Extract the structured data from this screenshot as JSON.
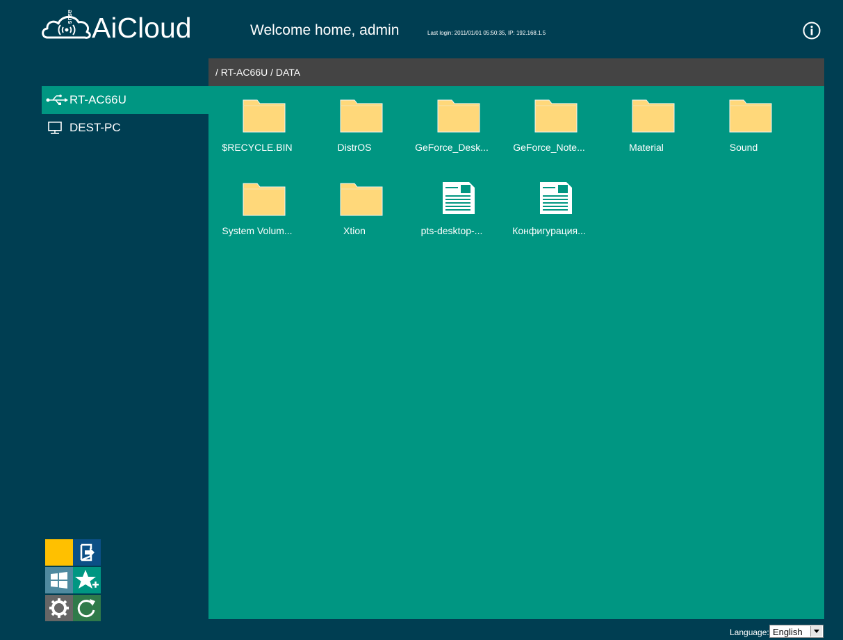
{
  "header": {
    "logo_text": "AiCloud",
    "logo_brand": "asus",
    "welcome": "Welcome home, admin",
    "last_login": "Last login: 2011/01/01 05:50:35, IP: 192.168.1.5",
    "info_icon": "info-icon"
  },
  "breadcrumb": {
    "path": "/ RT-AC66U / DATA"
  },
  "sidebar": {
    "items": [
      {
        "label": "RT-AC66U",
        "icon": "usb-icon",
        "active": true
      },
      {
        "label": "DEST-PC",
        "icon": "monitor-icon",
        "active": false
      }
    ]
  },
  "files": [
    {
      "name": "$RECYCLE.BIN",
      "type": "folder"
    },
    {
      "name": "DistrOS",
      "type": "folder"
    },
    {
      "name": "GeForce_Desk...",
      "type": "folder"
    },
    {
      "name": "GeForce_Note...",
      "type": "folder"
    },
    {
      "name": "Material",
      "type": "folder"
    },
    {
      "name": "Sound",
      "type": "folder"
    },
    {
      "name": "System Volum...",
      "type": "folder"
    },
    {
      "name": "Xtion",
      "type": "folder"
    },
    {
      "name": "pts-desktop-...",
      "type": "file"
    },
    {
      "name": "Конфигурация...",
      "type": "file"
    }
  ],
  "quick_tiles": [
    {
      "icon": "blank-tile",
      "color": "#ffc000"
    },
    {
      "icon": "logout-icon",
      "color": "#0b4f86"
    },
    {
      "icon": "windows-icon",
      "color": "#4f8aa0"
    },
    {
      "icon": "favorite-add-icon",
      "color": "#009682"
    },
    {
      "icon": "gear-icon",
      "color": "#666666"
    },
    {
      "icon": "refresh-icon",
      "color": "#2f7a4a"
    }
  ],
  "language": {
    "label": "Language:",
    "selected": "English"
  },
  "colors": {
    "background": "#003e52",
    "content": "#009682",
    "path_bar": "#444444",
    "folder": "#ffd87a"
  }
}
